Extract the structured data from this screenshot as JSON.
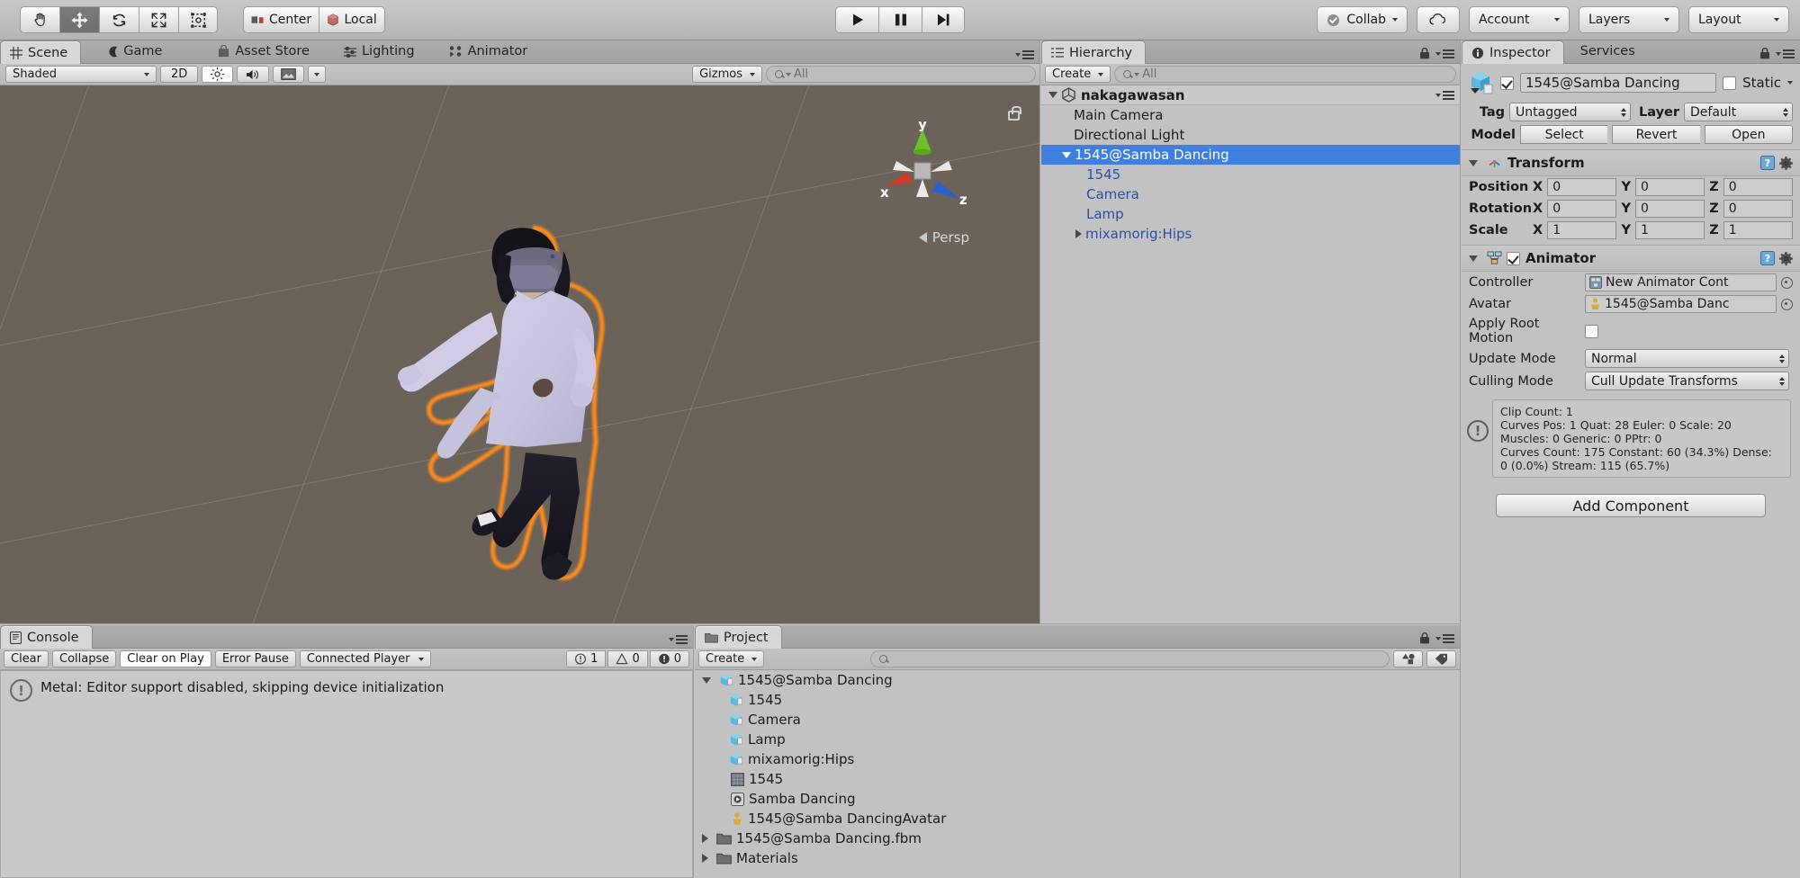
{
  "toolbar": {
    "tools": [
      {
        "name": "hand-tool",
        "active": false
      },
      {
        "name": "move-tool",
        "active": true
      },
      {
        "name": "rotate-tool",
        "active": false
      },
      {
        "name": "scale-tool",
        "active": false
      },
      {
        "name": "rect-tool",
        "active": false
      }
    ],
    "pivot_label": "Center",
    "space_label": "Local",
    "play_label": "play",
    "pause_label": "pause",
    "step_label": "step",
    "collab_label": "Collab",
    "cloud_label": "cloud",
    "account_label": "Account",
    "layers_label": "Layers",
    "layout_label": "Layout"
  },
  "scene_panel": {
    "tabs": [
      {
        "label": "Scene",
        "icon": "grid-icon",
        "active": true
      },
      {
        "label": "Game",
        "icon": "gamepad-icon",
        "active": false
      },
      {
        "label": "Asset Store",
        "icon": "store-icon",
        "active": false
      },
      {
        "label": "Lighting",
        "icon": "lighting-icon",
        "active": false
      },
      {
        "label": "Animator",
        "icon": "animator-icon",
        "active": false
      }
    ],
    "draw_mode": "Shaded",
    "mode_2d": "2D",
    "gizmos_label": "Gizmos",
    "search_placeholder": "All",
    "search_value": "",
    "axis_x": "x",
    "axis_y": "y",
    "axis_z": "z",
    "projection_label": "Persp"
  },
  "hierarchy": {
    "title": "Hierarchy",
    "create_label": "Create",
    "search_placeholder": "All",
    "search_value": "",
    "items": [
      {
        "label": "nakagawasan",
        "depth": 0,
        "expanded": true,
        "type": "scene",
        "selected": false
      },
      {
        "label": "Main Camera",
        "depth": 1,
        "expanded": null,
        "type": "object",
        "selected": false
      },
      {
        "label": "Directional Light",
        "depth": 1,
        "expanded": null,
        "type": "object",
        "selected": false
      },
      {
        "label": "1545@Samba Dancing",
        "depth": 1,
        "expanded": true,
        "type": "prefab",
        "selected": true
      },
      {
        "label": "1545",
        "depth": 2,
        "expanded": null,
        "type": "prefab",
        "selected": false
      },
      {
        "label": "Camera",
        "depth": 2,
        "expanded": null,
        "type": "prefab",
        "selected": false
      },
      {
        "label": "Lamp",
        "depth": 2,
        "expanded": null,
        "type": "prefab",
        "selected": false
      },
      {
        "label": "mixamorig:Hips",
        "depth": 2,
        "expanded": false,
        "type": "prefab",
        "selected": false
      }
    ]
  },
  "inspector": {
    "tabs": [
      {
        "label": "Inspector",
        "active": true
      },
      {
        "label": "Services",
        "active": false
      }
    ],
    "object_name": "1545@Samba Dancing",
    "enabled": true,
    "static_label": "Static",
    "static_checked": false,
    "tag_label": "Tag",
    "tag_value": "Untagged",
    "layer_label": "Layer",
    "layer_value": "Default",
    "model_label": "Model",
    "model_buttons": [
      "Select",
      "Revert",
      "Open"
    ],
    "transform": {
      "title": "Transform",
      "rows": [
        {
          "label": "Position",
          "x": "0",
          "y": "0",
          "z": "0"
        },
        {
          "label": "Rotation",
          "x": "0",
          "y": "0",
          "z": "0"
        },
        {
          "label": "Scale",
          "x": "1",
          "y": "1",
          "z": "1"
        }
      ],
      "axis_labels": [
        "X",
        "Y",
        "Z"
      ]
    },
    "animator": {
      "title": "Animator",
      "enabled": true,
      "controller_label": "Controller",
      "controller_value": "New Animator Cont",
      "avatar_label": "Avatar",
      "avatar_value": "1545@Samba Danc",
      "apply_root_motion_label": "Apply Root Motion",
      "apply_root_motion_checked": false,
      "update_mode_label": "Update Mode",
      "update_mode_value": "Normal",
      "culling_mode_label": "Culling Mode",
      "culling_mode_value": "Cull Update Transforms",
      "info_lines": [
        "Clip Count: 1",
        "Curves Pos: 1 Quat: 28 Euler: 0 Scale: 20",
        "Muscles: 0 Generic: 0 PPtr: 0",
        "Curves Count: 175 Constant: 60 (34.3%) Dense:",
        "0 (0.0%) Stream: 115 (65.7%)"
      ]
    },
    "add_component_label": "Add Component"
  },
  "console": {
    "title": "Console",
    "buttons": [
      "Clear",
      "Collapse",
      "Clear on Play",
      "Error Pause"
    ],
    "active_button": "Clear on Play",
    "connected_player_label": "Connected Player",
    "counts": {
      "info": "1",
      "warning": "0",
      "error": "0"
    },
    "messages": [
      {
        "icon": "info-icon",
        "text": "Metal: Editor support disabled, skipping device initialization"
      }
    ]
  },
  "project": {
    "title": "Project",
    "create_label": "Create",
    "search_placeholder": "",
    "search_value": "",
    "items": [
      {
        "label": "1545@Samba Dancing",
        "depth": 0,
        "expanded": true,
        "icon": "prefab-icon"
      },
      {
        "label": "1545",
        "depth": 1,
        "expanded": null,
        "icon": "prefab-icon"
      },
      {
        "label": "Camera",
        "depth": 1,
        "expanded": null,
        "icon": "prefab-icon"
      },
      {
        "label": "Lamp",
        "depth": 1,
        "expanded": null,
        "icon": "prefab-icon"
      },
      {
        "label": "mixamorig:Hips",
        "depth": 1,
        "expanded": null,
        "icon": "prefab-icon"
      },
      {
        "label": "1545",
        "depth": 1,
        "expanded": null,
        "icon": "mesh-icon"
      },
      {
        "label": "Samba Dancing",
        "depth": 1,
        "expanded": null,
        "icon": "animation-icon"
      },
      {
        "label": "1545@Samba DancingAvatar",
        "depth": 1,
        "expanded": null,
        "icon": "avatar-icon"
      },
      {
        "label": "1545@Samba Dancing.fbm",
        "depth": 0,
        "expanded": false,
        "icon": "folder-icon"
      },
      {
        "label": "Materials",
        "depth": 0,
        "expanded": false,
        "icon": "folder-icon"
      }
    ]
  },
  "colors": {
    "selection_blue": "#3e7fe0",
    "scene_bg": "#6b6259",
    "outline_orange": "#ff8c1a",
    "panel_bg": "#c2c2c2",
    "prefab_blue": "#2f4f9e"
  }
}
